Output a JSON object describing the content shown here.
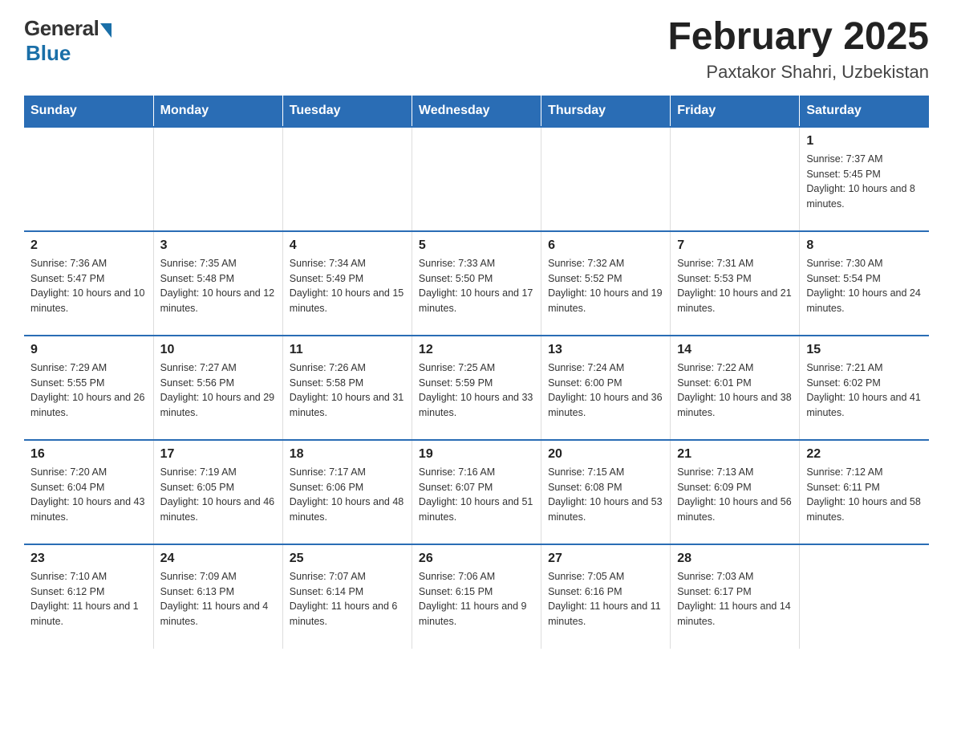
{
  "logo": {
    "general": "General",
    "blue": "Blue"
  },
  "header": {
    "month": "February 2025",
    "location": "Paxtakor Shahri, Uzbekistan"
  },
  "days_of_week": [
    "Sunday",
    "Monday",
    "Tuesday",
    "Wednesday",
    "Thursday",
    "Friday",
    "Saturday"
  ],
  "weeks": [
    [
      {
        "day": "",
        "info": ""
      },
      {
        "day": "",
        "info": ""
      },
      {
        "day": "",
        "info": ""
      },
      {
        "day": "",
        "info": ""
      },
      {
        "day": "",
        "info": ""
      },
      {
        "day": "",
        "info": ""
      },
      {
        "day": "1",
        "info": "Sunrise: 7:37 AM\nSunset: 5:45 PM\nDaylight: 10 hours and 8 minutes."
      }
    ],
    [
      {
        "day": "2",
        "info": "Sunrise: 7:36 AM\nSunset: 5:47 PM\nDaylight: 10 hours and 10 minutes."
      },
      {
        "day": "3",
        "info": "Sunrise: 7:35 AM\nSunset: 5:48 PM\nDaylight: 10 hours and 12 minutes."
      },
      {
        "day": "4",
        "info": "Sunrise: 7:34 AM\nSunset: 5:49 PM\nDaylight: 10 hours and 15 minutes."
      },
      {
        "day": "5",
        "info": "Sunrise: 7:33 AM\nSunset: 5:50 PM\nDaylight: 10 hours and 17 minutes."
      },
      {
        "day": "6",
        "info": "Sunrise: 7:32 AM\nSunset: 5:52 PM\nDaylight: 10 hours and 19 minutes."
      },
      {
        "day": "7",
        "info": "Sunrise: 7:31 AM\nSunset: 5:53 PM\nDaylight: 10 hours and 21 minutes."
      },
      {
        "day": "8",
        "info": "Sunrise: 7:30 AM\nSunset: 5:54 PM\nDaylight: 10 hours and 24 minutes."
      }
    ],
    [
      {
        "day": "9",
        "info": "Sunrise: 7:29 AM\nSunset: 5:55 PM\nDaylight: 10 hours and 26 minutes."
      },
      {
        "day": "10",
        "info": "Sunrise: 7:27 AM\nSunset: 5:56 PM\nDaylight: 10 hours and 29 minutes."
      },
      {
        "day": "11",
        "info": "Sunrise: 7:26 AM\nSunset: 5:58 PM\nDaylight: 10 hours and 31 minutes."
      },
      {
        "day": "12",
        "info": "Sunrise: 7:25 AM\nSunset: 5:59 PM\nDaylight: 10 hours and 33 minutes."
      },
      {
        "day": "13",
        "info": "Sunrise: 7:24 AM\nSunset: 6:00 PM\nDaylight: 10 hours and 36 minutes."
      },
      {
        "day": "14",
        "info": "Sunrise: 7:22 AM\nSunset: 6:01 PM\nDaylight: 10 hours and 38 minutes."
      },
      {
        "day": "15",
        "info": "Sunrise: 7:21 AM\nSunset: 6:02 PM\nDaylight: 10 hours and 41 minutes."
      }
    ],
    [
      {
        "day": "16",
        "info": "Sunrise: 7:20 AM\nSunset: 6:04 PM\nDaylight: 10 hours and 43 minutes."
      },
      {
        "day": "17",
        "info": "Sunrise: 7:19 AM\nSunset: 6:05 PM\nDaylight: 10 hours and 46 minutes."
      },
      {
        "day": "18",
        "info": "Sunrise: 7:17 AM\nSunset: 6:06 PM\nDaylight: 10 hours and 48 minutes."
      },
      {
        "day": "19",
        "info": "Sunrise: 7:16 AM\nSunset: 6:07 PM\nDaylight: 10 hours and 51 minutes."
      },
      {
        "day": "20",
        "info": "Sunrise: 7:15 AM\nSunset: 6:08 PM\nDaylight: 10 hours and 53 minutes."
      },
      {
        "day": "21",
        "info": "Sunrise: 7:13 AM\nSunset: 6:09 PM\nDaylight: 10 hours and 56 minutes."
      },
      {
        "day": "22",
        "info": "Sunrise: 7:12 AM\nSunset: 6:11 PM\nDaylight: 10 hours and 58 minutes."
      }
    ],
    [
      {
        "day": "23",
        "info": "Sunrise: 7:10 AM\nSunset: 6:12 PM\nDaylight: 11 hours and 1 minute."
      },
      {
        "day": "24",
        "info": "Sunrise: 7:09 AM\nSunset: 6:13 PM\nDaylight: 11 hours and 4 minutes."
      },
      {
        "day": "25",
        "info": "Sunrise: 7:07 AM\nSunset: 6:14 PM\nDaylight: 11 hours and 6 minutes."
      },
      {
        "day": "26",
        "info": "Sunrise: 7:06 AM\nSunset: 6:15 PM\nDaylight: 11 hours and 9 minutes."
      },
      {
        "day": "27",
        "info": "Sunrise: 7:05 AM\nSunset: 6:16 PM\nDaylight: 11 hours and 11 minutes."
      },
      {
        "day": "28",
        "info": "Sunrise: 7:03 AM\nSunset: 6:17 PM\nDaylight: 11 hours and 14 minutes."
      },
      {
        "day": "",
        "info": ""
      }
    ]
  ]
}
